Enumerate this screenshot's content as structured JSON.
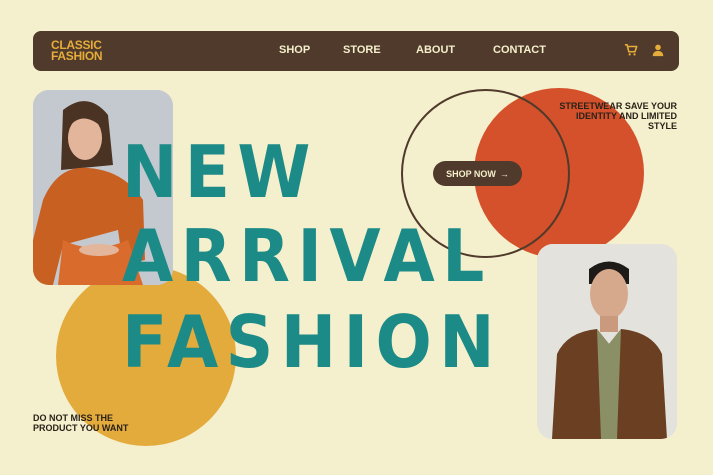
{
  "brand": {
    "line1": "CLASSIC",
    "line2": "FASHION"
  },
  "nav": {
    "items": [
      "SHOP",
      "STORE",
      "ABOUT",
      "CONTACT"
    ]
  },
  "icons": {
    "cart": "cart-icon",
    "user": "user-icon"
  },
  "hero": {
    "lines": [
      "NEW",
      "ARRIVAL",
      "FASHION"
    ],
    "cta": "SHOP NOW",
    "cta_arrow": "→",
    "tagline": "STREETWEAR SAVE YOUR IDENTITY AND LIMITED STYLE",
    "promo": "DO NOT MISS THE PRODUCT YOU WANT"
  },
  "colors": {
    "background": "#f4efcc",
    "nav_bg": "#4f3a2b",
    "teal": "#1c8a87",
    "orange": "#d4512b",
    "yellow": "#e3ab3c"
  }
}
